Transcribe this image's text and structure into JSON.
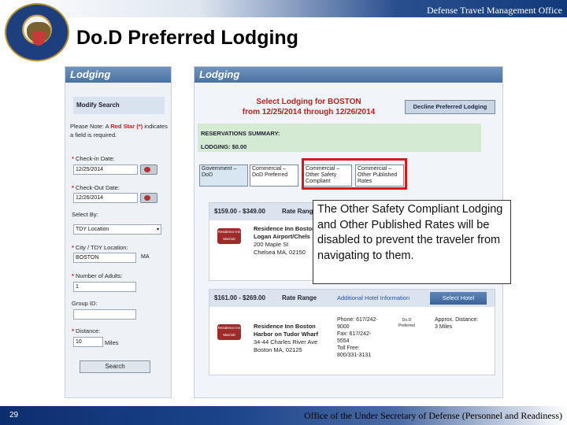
{
  "header": {
    "org_title": "Defense Travel Management Office",
    "slide_title": "Do.D Preferred Lodging"
  },
  "footer": {
    "page_number": "29",
    "office": "Office of the Under Secretary of Defense (Personnel and Readiness)"
  },
  "left_panel": {
    "header": "Lodging",
    "modify_search": "Modify Search",
    "note_prefix": "Please Note: A",
    "note_red": "Red Star (*)",
    "note_suffix": "indicates a field is required.",
    "fields": {
      "checkin_label": "Check-in Date:",
      "checkin_value": "12/25/2014",
      "checkout_label": "Check-Out Date:",
      "checkout_value": "12/26/2014",
      "select_by_label": "Select By:",
      "select_by_value": "TDY Location",
      "city_label": "City / TDY Location:",
      "city_value": "BOSTON",
      "state_value": "MA",
      "adults_label": "Number of Adults:",
      "adults_value": "1",
      "group_label": "Group ID:",
      "distance_label": "Distance:",
      "distance_value": "10",
      "distance_unit": "Miles"
    },
    "search_button": "Search"
  },
  "right_panel": {
    "header": "Lodging",
    "title_line1": "Select Lodging for BOSTON",
    "title_line2": "from 12/25/2014 through 12/26/2014",
    "decline_button": "Decline Preferred Lodging",
    "reservations_summary": "RESERVATIONS SUMMARY:",
    "lodging_total": "LODGING:   $0.00",
    "tabs": [
      {
        "label": "Government – DoD"
      },
      {
        "label": "Commercial – DoD Preferred"
      },
      {
        "label": "Commercial – Other Safety Compliant"
      },
      {
        "label": "Commercial – Other Published Rates"
      }
    ],
    "hotels": [
      {
        "price": "$159.00 - $349.00",
        "rate_range": "Rate Range",
        "logo": "Residence Inn Marriott",
        "name_line1": "Residence Inn Boston",
        "name_line2": "Logan Airport/Chels",
        "addr_line1": "200 Maple St",
        "addr_line2": "Chelsea MA, 02150"
      },
      {
        "price": "$161.00 - $269.00",
        "rate_range": "Rate Range",
        "additional": "Additional Hotel Information",
        "select_button": "Select Hotel",
        "logo": "Residence Inn Marriott",
        "name_line1": "Residence Inn Boston",
        "name_line2": "Harbor on Tudor Wharf",
        "addr_line1": "34-44 Charles River Ave",
        "addr_line2": "Boston MA, 02125",
        "phone_line1": "Phone: 617/242-",
        "phone_line2": "9000",
        "fax_line1": "Fax: 617/242-",
        "fax_line2": "5554",
        "tollfree_line1": "Toll Free:",
        "tollfree_line2": "800/331-3131",
        "dod_line1": "Do.D",
        "dod_line2": "Preferred",
        "distance_line1": "Approx. Distance:",
        "distance_line2": "3 Miles"
      }
    ]
  },
  "callout_text": "The Other Safety Compliant Lodging and Other Published Rates will be disabled to prevent the traveler from navigating to them."
}
